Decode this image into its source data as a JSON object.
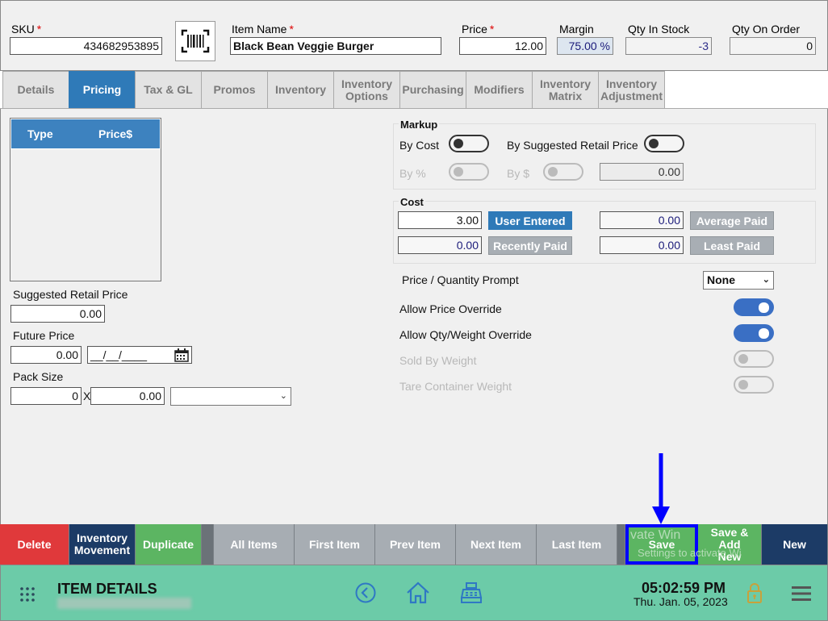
{
  "header": {
    "sku_label": "SKU",
    "sku_value": "434682953895",
    "item_name_label": "Item Name",
    "item_name_value": "Black Bean Veggie Burger",
    "price_label": "Price",
    "price_value": "12.00",
    "margin_label": "Margin",
    "margin_value": "75.00 %",
    "qty_in_stock_label": "Qty In Stock",
    "qty_in_stock_value": "-3",
    "qty_on_order_label": "Qty On Order",
    "qty_on_order_value": "0",
    "required_mark": "*"
  },
  "tabs": [
    {
      "label": "Details",
      "active": false
    },
    {
      "label": "Pricing",
      "active": true
    },
    {
      "label": "Tax & GL",
      "active": false
    },
    {
      "label": "Promos",
      "active": false
    },
    {
      "label": "Inventory",
      "active": false
    },
    {
      "label": "Inventory Options",
      "active": false
    },
    {
      "label": "Purchasing",
      "active": false
    },
    {
      "label": "Modifiers",
      "active": false
    },
    {
      "label": "Inventory Matrix",
      "active": false
    },
    {
      "label": "Inventory Adjustment",
      "active": false
    }
  ],
  "price_table": {
    "col_type": "Type",
    "col_price": "Price$"
  },
  "left": {
    "suggested_retail_label": "Suggested Retail Price",
    "suggested_retail_value": "0.00",
    "future_price_label": "Future Price",
    "future_price_value": "0.00",
    "future_date_value": "__/__/____",
    "pack_size_label": "Pack Size",
    "pack_qty_value": "0",
    "pack_x": "X",
    "pack_price_value": "0.00",
    "pack_unit_value": ""
  },
  "markup": {
    "title": "Markup",
    "by_cost_label": "By Cost",
    "by_srp_label": "By Suggested Retail Price",
    "by_pct_label": "By %",
    "by_dollar_label": "By $",
    "value": "0.00"
  },
  "cost": {
    "title": "Cost",
    "user_entered_value": "3.00",
    "user_entered_label": "User Entered",
    "recently_paid_value": "0.00",
    "recently_paid_label": "Recently Paid",
    "average_paid_value": "0.00",
    "average_paid_label": "Average Paid",
    "least_paid_value": "0.00",
    "least_paid_label": "Least Paid"
  },
  "options": {
    "price_qty_prompt_label": "Price / Quantity Prompt",
    "price_qty_prompt_value": "None",
    "allow_price_override_label": "Allow Price Override",
    "allow_price_override_on": true,
    "allow_qty_weight_override_label": "Allow Qty/Weight Override",
    "allow_qty_weight_override_on": true,
    "sold_by_weight_label": "Sold By Weight",
    "sold_by_weight_on": false,
    "tare_container_weight_label": "Tare Container Weight",
    "tare_container_weight_on": false
  },
  "toolbar": {
    "delete": "Delete",
    "inventory_movement": "Inventory Movement",
    "duplicate": "Duplicate",
    "all_items": "All Items",
    "first_item": "First Item",
    "prev_item": "Prev Item",
    "next_item": "Next Item",
    "last_item": "Last Item",
    "save": "Save",
    "save_add_new": "Save & Add New",
    "new": "New",
    "watermark_line1": "vate Win",
    "watermark_line2": "Settings to activate Wi"
  },
  "footer": {
    "title": "ITEM DETAILS",
    "time": "05:02:59 PM",
    "date": "Thu. Jan. 05, 2023"
  },
  "colors": {
    "accent_blue": "#2f7ab8",
    "footer_green": "#6ccba8",
    "delete_red": "#e0393b",
    "annotation_blue": "#0000ff"
  }
}
